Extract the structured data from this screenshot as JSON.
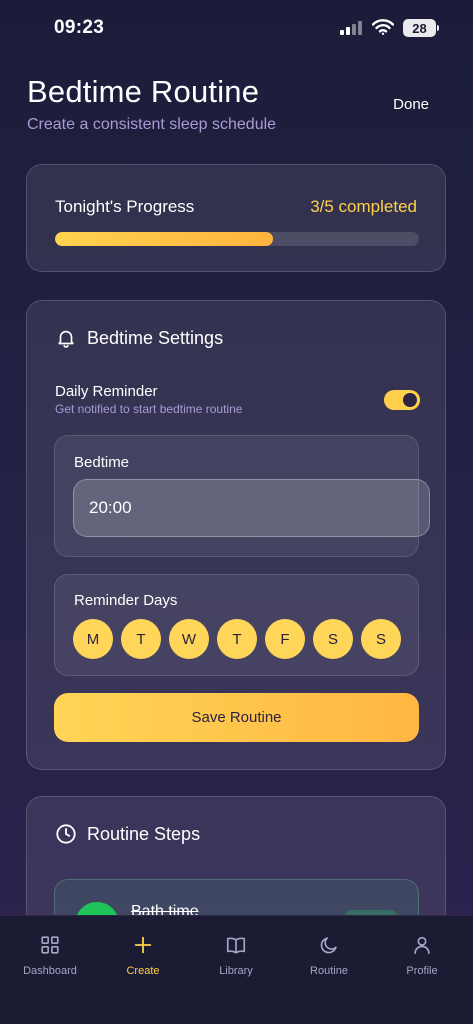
{
  "status_bar": {
    "time": "09:23",
    "battery": "28"
  },
  "header": {
    "title": "Bedtime Routine",
    "subtitle": "Create a consistent sleep schedule",
    "done_label": "Done"
  },
  "progress": {
    "label": "Tonight's Progress",
    "count_text": "3/5 completed",
    "completed": 3,
    "total": 5,
    "fraction": 0.6
  },
  "settings": {
    "title": "Bedtime Settings",
    "icon": "bell-icon",
    "reminder_title": "Daily Reminder",
    "reminder_subtitle": "Get notified to start bedtime routine",
    "reminder_enabled": true,
    "bedtime_label": "Bedtime",
    "bedtime_value": "20:00",
    "reminder_days_label": "Reminder Days",
    "days": [
      "M",
      "T",
      "W",
      "T",
      "F",
      "S",
      "S"
    ],
    "save_label": "Save Routine"
  },
  "steps": {
    "title": "Routine Steps",
    "icon": "clock-icon",
    "items": [
      {
        "label": "Bath time"
      }
    ]
  },
  "nav": {
    "items": [
      {
        "label": "Dashboard",
        "icon": "grid-icon"
      },
      {
        "label": "Create",
        "icon": "plus-icon"
      },
      {
        "label": "Library",
        "icon": "book-icon"
      },
      {
        "label": "Routine",
        "icon": "moon-icon"
      },
      {
        "label": "Profile",
        "icon": "user-icon"
      }
    ],
    "active": "Create"
  },
  "colors": {
    "accent": "#ffd04a",
    "subtitle": "#a99bd4",
    "background": "#1c1c3a",
    "step_done": "#1fc35a"
  }
}
